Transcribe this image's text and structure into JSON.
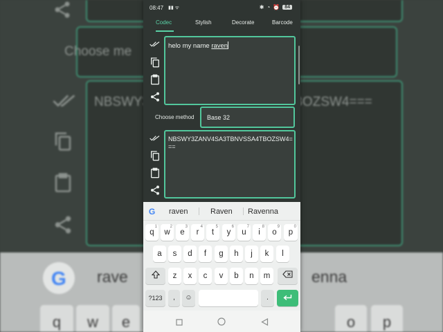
{
  "background": {
    "choose_method_text": "Choose me",
    "output_text": "NBSWY3ZANV4SA3TBNVSSA4TBOZSW4===",
    "suggestion_left": "rave",
    "suggestion_right": "enna",
    "keys_bottom": [
      "q",
      "w",
      "e",
      "o",
      "p"
    ]
  },
  "status_bar": {
    "time": "08:47",
    "battery": "84"
  },
  "tabs": [
    {
      "label": "Codec",
      "active": true
    },
    {
      "label": "Stylish",
      "active": false
    },
    {
      "label": "Decorate",
      "active": false
    },
    {
      "label": "Barcode",
      "active": false
    }
  ],
  "input": {
    "text_plain": "helo my name ",
    "text_underlined": "raven"
  },
  "method": {
    "label": "Choose method",
    "selected": "Base 32"
  },
  "output": {
    "text": "NBSWY3ZANV4SA3TBNVSSA4TBOZSW4==="
  },
  "keyboard": {
    "suggestions": [
      "raven",
      "Raven",
      "Ravenna"
    ],
    "row1": [
      {
        "k": "q",
        "h": "1"
      },
      {
        "k": "w",
        "h": "2"
      },
      {
        "k": "e",
        "h": "3"
      },
      {
        "k": "r",
        "h": "4"
      },
      {
        "k": "t",
        "h": "5"
      },
      {
        "k": "y",
        "h": "6"
      },
      {
        "k": "u",
        "h": "7"
      },
      {
        "k": "i",
        "h": "8"
      },
      {
        "k": "o",
        "h": "9"
      },
      {
        "k": "p",
        "h": "0"
      }
    ],
    "row2": [
      "a",
      "s",
      "d",
      "f",
      "g",
      "h",
      "j",
      "k",
      "l"
    ],
    "row3": [
      "z",
      "x",
      "c",
      "v",
      "b",
      "n",
      "m"
    ],
    "symbols_label": "?123",
    "comma": ",",
    "period": "."
  },
  "colors": {
    "accent": "#5ad1a6",
    "border": "#52c79c",
    "app_bg": "#2f3532",
    "enter": "#3dbd78"
  }
}
